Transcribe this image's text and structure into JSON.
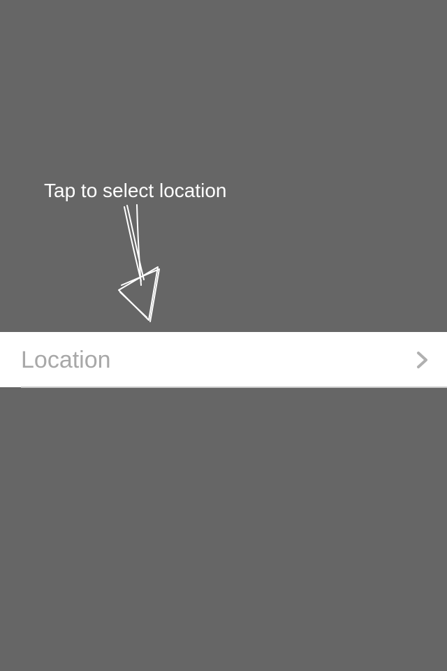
{
  "hint": {
    "text": "Tap to select location",
    "arrow_icon": "hand-drawn-arrow-down-icon"
  },
  "location_row": {
    "label": "Location",
    "chevron_icon": "chevron-right-icon"
  },
  "colors": {
    "overlay": "#666666",
    "row_background": "#ffffff",
    "label_text": "#a8a8a8",
    "chevron": "#b0b0b0",
    "hint_text": "#ffffff"
  }
}
